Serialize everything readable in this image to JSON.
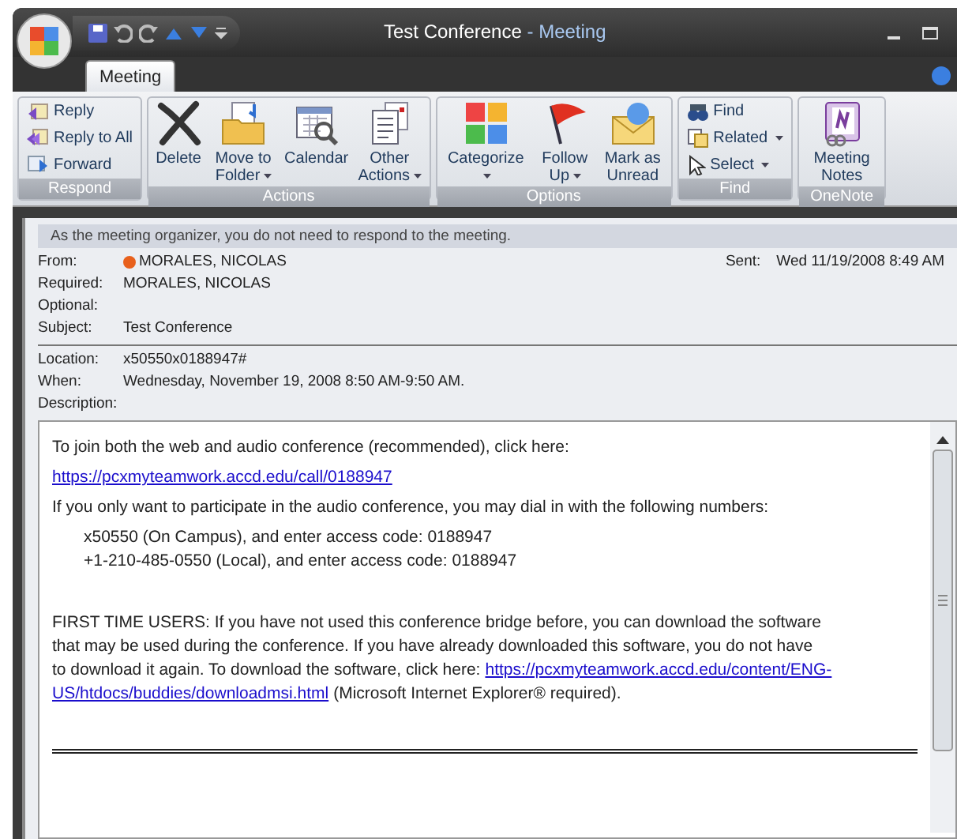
{
  "window": {
    "title": "Test Conference",
    "separator": "-",
    "subtitle": "Meeting"
  },
  "tabs": [
    {
      "label": "Meeting",
      "selected": true
    }
  ],
  "ribbon": {
    "groups": [
      {
        "name": "Respond",
        "items": [
          {
            "kind": "small",
            "label": "Reply"
          },
          {
            "kind": "small",
            "label": "Reply to All"
          },
          {
            "kind": "small",
            "label": "Forward"
          }
        ]
      },
      {
        "name": "Actions",
        "items": [
          {
            "kind": "large",
            "label": "Delete",
            "dropdown": false
          },
          {
            "kind": "large",
            "label": "Move to Folder",
            "dropdown": true
          },
          {
            "kind": "large",
            "label": "Calendar",
            "dropdown": false
          },
          {
            "kind": "large",
            "label": "Other Actions",
            "dropdown": true
          }
        ]
      },
      {
        "name": "Options",
        "items": [
          {
            "kind": "large",
            "label": "Categorize",
            "dropdown": true
          },
          {
            "kind": "large",
            "label": "Follow Up",
            "dropdown": true
          },
          {
            "kind": "large",
            "label": "Mark as Unread",
            "dropdown": false
          }
        ]
      },
      {
        "name": "Find",
        "items": [
          {
            "kind": "small",
            "label": "Find",
            "dropdown": false
          },
          {
            "kind": "small",
            "label": "Related",
            "dropdown": true
          },
          {
            "kind": "small",
            "label": "Select",
            "dropdown": true
          }
        ]
      },
      {
        "name": "OneNote",
        "items": [
          {
            "kind": "large",
            "label": "Meeting Notes",
            "dropdown": false
          }
        ]
      }
    ]
  },
  "info_bar": "As the meeting organizer, you do not need to respond to the meeting.",
  "header": [
    {
      "label": "From:",
      "value": "MORALES, NICOLAS",
      "presence": true
    },
    {
      "label": "Required:",
      "value": "MORALES, NICOLAS"
    },
    {
      "label": "Optional:"
    },
    {
      "label": "Subject:",
      "value": "Test Conference"
    }
  ],
  "sent": {
    "label": "Sent:",
    "value": "Wed 11/19/2008 8:49 AM"
  },
  "details": [
    {
      "label": "Location:",
      "value": "x50550x0188947#"
    },
    {
      "label": "When:",
      "value": "Wednesday, November 19, 2008 8:50 AM-9:50 AM."
    },
    {
      "label": "Description:"
    }
  ],
  "body": [
    {
      "kind": "para",
      "text": "To join both the web and audio conference (recommended), click here:"
    },
    {
      "kind": "link",
      "text": "https://pcxmyteamwork.accd.edu/call/0188947"
    },
    {
      "kind": "para",
      "text": "If you only want to participate in the audio conference, you may dial in with the following numbers:"
    },
    {
      "kind": "indent",
      "lines": [
        "x50550 (On Campus), and enter access code: 0188947",
        "+1-210-485-0550 (Local), and enter access code: 0188947"
      ]
    },
    {
      "kind": "rich",
      "lines": [
        [
          {
            "kind": "text",
            "text": "FIRST TIME USERS: If you have not used this conference bridge before, you can download the software"
          }
        ],
        [
          {
            "kind": "text",
            "text": "that may be used during the conference. If you have already downloaded this software, you do not have"
          }
        ],
        [
          {
            "kind": "text",
            "text": "to download it again. To download the software, click here:"
          },
          {
            "kind": "link",
            "text": "https://pcxmyteamwork.accd.edu/content/ENG-"
          }
        ],
        [
          {
            "kind": "link",
            "text": "US/htdocs/buddies/downloadmsi.html"
          },
          {
            "kind": "text",
            "text": "(Microsoft Internet Explorer® required)."
          }
        ]
      ]
    },
    {
      "kind": "rule"
    }
  ]
}
